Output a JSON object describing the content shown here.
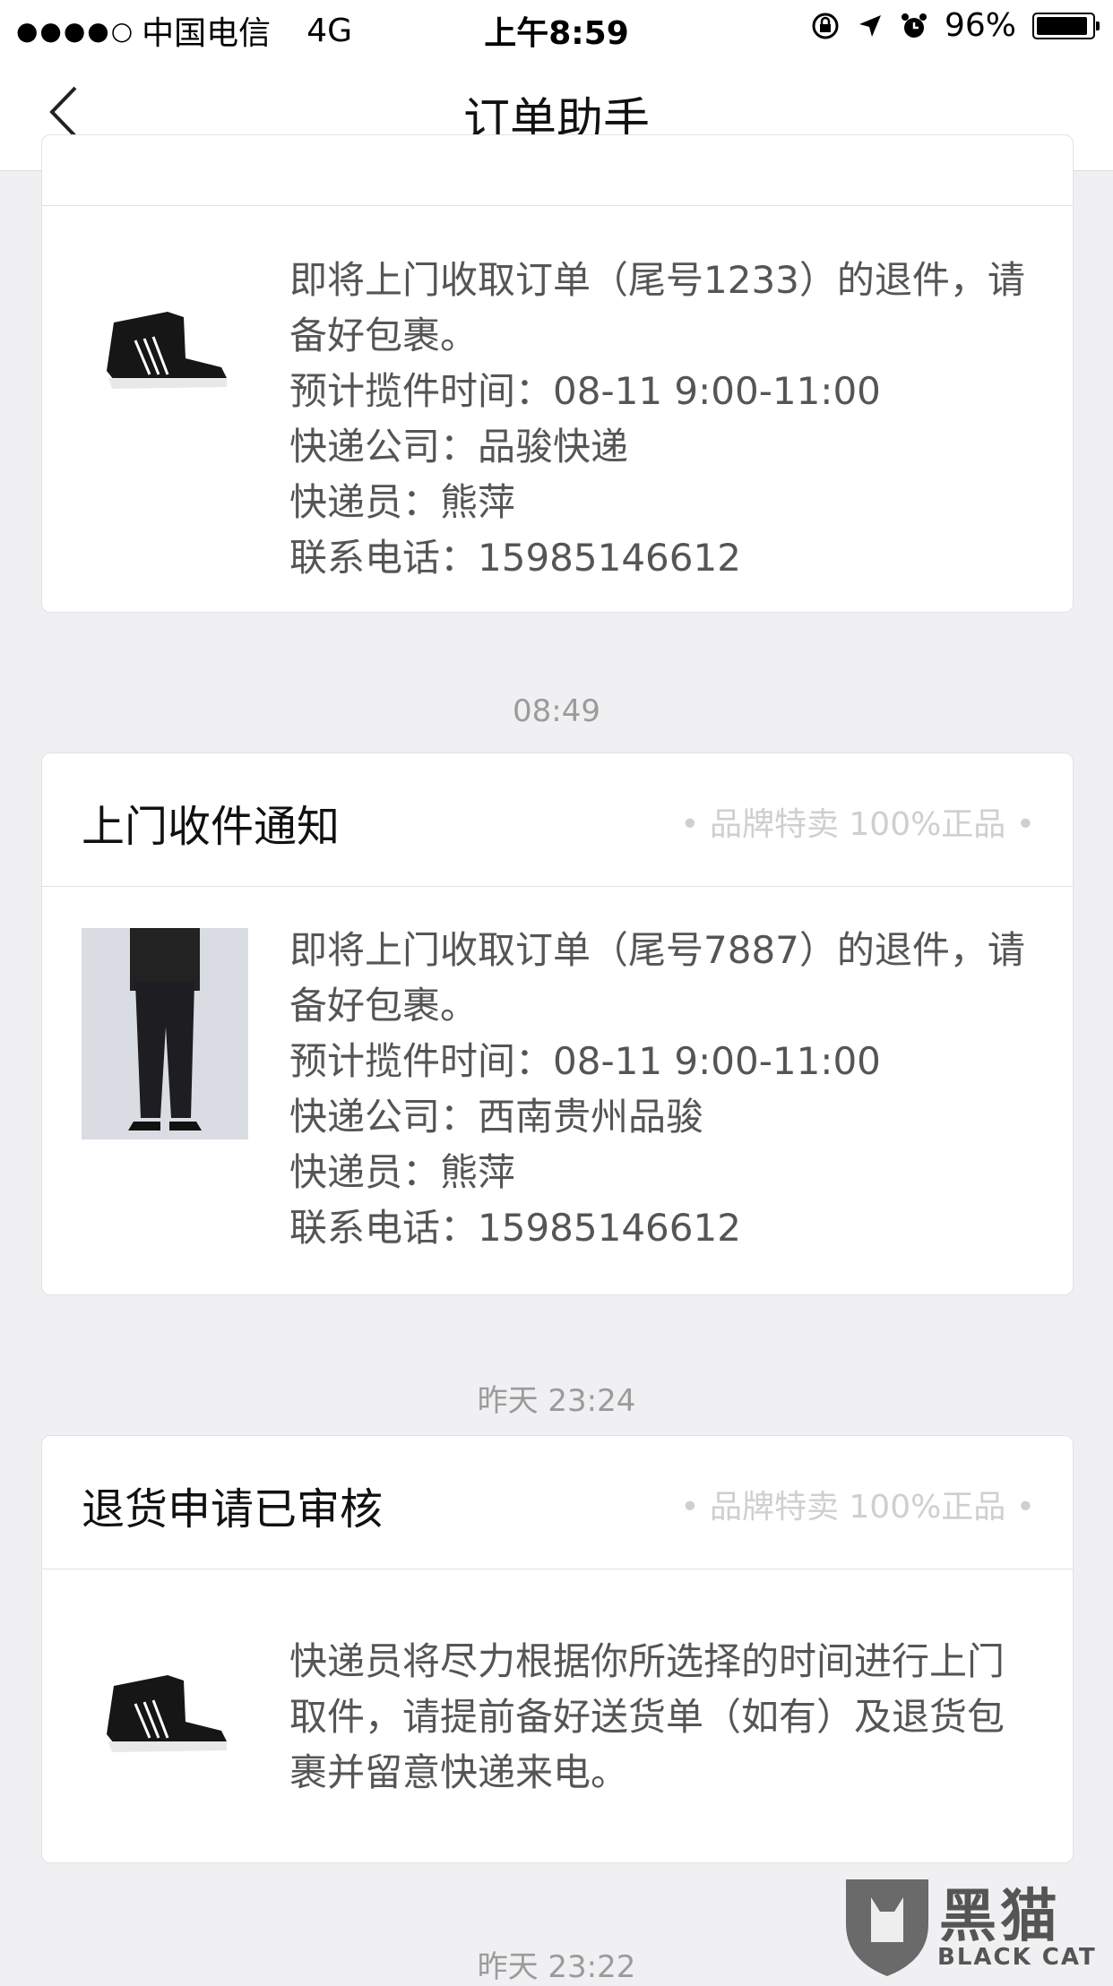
{
  "status_bar": {
    "signal": "●●●●○",
    "carrier": "中国电信",
    "network": "4G",
    "time": "上午8:59",
    "battery": "96%"
  },
  "nav": {
    "title": "订单助手"
  },
  "cards": [
    {
      "lines": [
        "即将上门收取订单（尾号1233）的退件，请备好包裹。",
        "预计揽件时间：08-11 9:00-11:00",
        "快递公司：品骏快递",
        "快递员：熊萍",
        "联系电话：15985146612"
      ]
    },
    {
      "title": "上门收件通知",
      "tag": "• 品牌特卖 100%正品 •",
      "lines": [
        "即将上门收取订单（尾号7887）的退件，请备好包裹。",
        "预计揽件时间：08-11 9:00-11:00",
        "快递公司：西南贵州品骏",
        "快递员：熊萍",
        "联系电话：15985146612"
      ]
    },
    {
      "title": "退货申请已审核",
      "tag": "• 品牌特卖 100%正品 •",
      "lines": [
        "快递员将尽力根据你所选择的时间进行上门取件，请提前备好送货单（如有）及退货包裹并留意快递来电。"
      ]
    }
  ],
  "timestamps": [
    "08:49",
    "昨天 23:24",
    "昨天 23:22"
  ],
  "watermark": {
    "cn": "黑猫",
    "en": "BLACK CAT"
  },
  "colors": {
    "background": "#f0f0f2",
    "card": "#ffffff",
    "timestamp": "#9b9b9b",
    "tag": "#cfcfcf"
  }
}
